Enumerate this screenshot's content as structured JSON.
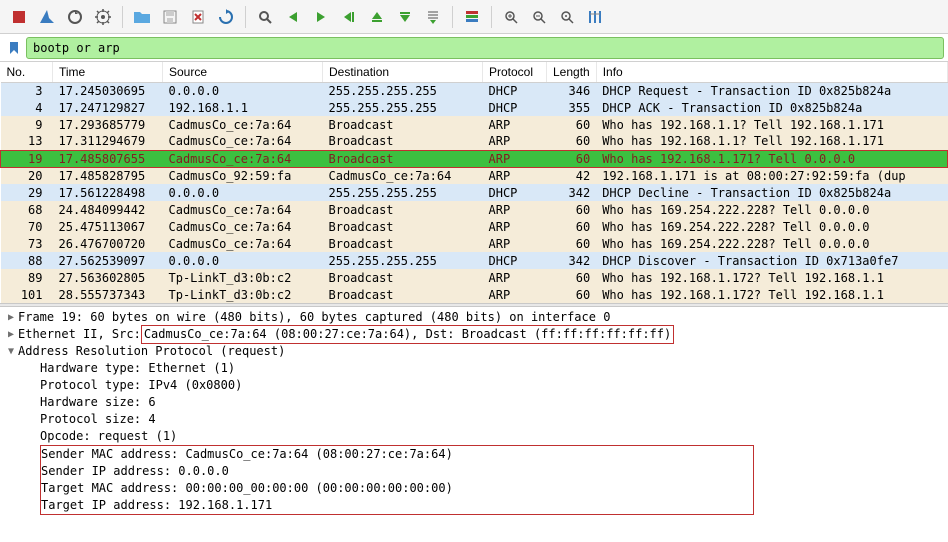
{
  "filter": {
    "value": "bootp or arp"
  },
  "icons": {
    "stop": "stop",
    "fin": "fin",
    "reload": "reload",
    "gear": "gear",
    "folder": "folder",
    "save": "save",
    "close": "close",
    "magnify": "magnify",
    "left": "left",
    "right": "right",
    "jmpl": "jmpl",
    "jmpr": "jmpr",
    "up": "up",
    "down": "down",
    "list": "list",
    "align": "align",
    "zin": "zin",
    "zout": "zout",
    "z100": "z100",
    "cols": "cols"
  },
  "columns": {
    "no": "No.",
    "time": "Time",
    "src": "Source",
    "dst": "Destination",
    "proto": "Protocol",
    "len": "Length",
    "info": "Info"
  },
  "rows": [
    {
      "cls": "row-blue",
      "no": "3",
      "time": "17.245030695",
      "src": "0.0.0.0",
      "dst": "255.255.255.255",
      "proto": "DHCP",
      "len": "346",
      "info": "DHCP Request  - Transaction ID 0x825b824a"
    },
    {
      "cls": "row-blue",
      "no": "4",
      "time": "17.247129827",
      "src": "192.168.1.1",
      "dst": "255.255.255.255",
      "proto": "DHCP",
      "len": "355",
      "info": "DHCP ACK      - Transaction ID 0x825b824a"
    },
    {
      "cls": "row-tan",
      "no": "9",
      "time": "17.293685779",
      "src": "CadmusCo_ce:7a:64",
      "dst": "Broadcast",
      "proto": "ARP",
      "len": "60",
      "info": "Who has 192.168.1.1? Tell 192.168.1.171"
    },
    {
      "cls": "row-tan",
      "no": "13",
      "time": "17.311294679",
      "src": "CadmusCo_ce:7a:64",
      "dst": "Broadcast",
      "proto": "ARP",
      "len": "60",
      "info": "Who has 192.168.1.1? Tell 192.168.1.171"
    },
    {
      "cls": "row-sel",
      "no": "19",
      "time": "17.485807655",
      "src": "CadmusCo_ce:7a:64",
      "dst": "Broadcast",
      "proto": "ARP",
      "len": "60",
      "info": "Who has 192.168.1.171? Tell 0.0.0.0"
    },
    {
      "cls": "row-tan",
      "no": "20",
      "time": "17.485828795",
      "src": "CadmusCo_92:59:fa",
      "dst": "CadmusCo_ce:7a:64",
      "proto": "ARP",
      "len": "42",
      "info": "192.168.1.171 is at 08:00:27:92:59:fa (dup"
    },
    {
      "cls": "row-blue",
      "no": "29",
      "time": "17.561228498",
      "src": "0.0.0.0",
      "dst": "255.255.255.255",
      "proto": "DHCP",
      "len": "342",
      "info": "DHCP Decline  - Transaction ID 0x825b824a"
    },
    {
      "cls": "row-tan",
      "no": "68",
      "time": "24.484099442",
      "src": "CadmusCo_ce:7a:64",
      "dst": "Broadcast",
      "proto": "ARP",
      "len": "60",
      "info": "Who has 169.254.222.228? Tell 0.0.0.0"
    },
    {
      "cls": "row-tan",
      "no": "70",
      "time": "25.475113067",
      "src": "CadmusCo_ce:7a:64",
      "dst": "Broadcast",
      "proto": "ARP",
      "len": "60",
      "info": "Who has 169.254.222.228? Tell 0.0.0.0"
    },
    {
      "cls": "row-tan",
      "no": "73",
      "time": "26.476700720",
      "src": "CadmusCo_ce:7a:64",
      "dst": "Broadcast",
      "proto": "ARP",
      "len": "60",
      "info": "Who has 169.254.222.228? Tell 0.0.0.0"
    },
    {
      "cls": "row-blue",
      "no": "88",
      "time": "27.562539097",
      "src": "0.0.0.0",
      "dst": "255.255.255.255",
      "proto": "DHCP",
      "len": "342",
      "info": "DHCP Discover - Transaction ID 0x713a0fe7"
    },
    {
      "cls": "row-tan",
      "no": "89",
      "time": "27.563602805",
      "src": "Tp-LinkT_d3:0b:c2",
      "dst": "Broadcast",
      "proto": "ARP",
      "len": "60",
      "info": "Who has 192.168.1.172? Tell 192.168.1.1"
    },
    {
      "cls": "row-tan",
      "no": "101",
      "time": "28.555737343",
      "src": "Tp-LinkT_d3:0b:c2",
      "dst": "Broadcast",
      "proto": "ARP",
      "len": "60",
      "info": "Who has 192.168.1.172? Tell 192.168.1.1"
    }
  ],
  "details": {
    "frame": "Frame 19: 60 bytes on wire (480 bits), 60 bytes captured (480 bits) on interface 0",
    "eth_prefix": "Ethernet II, Src: ",
    "eth_box": "CadmusCo_ce:7a:64 (08:00:27:ce:7a:64), Dst: Broadcast (ff:ff:ff:ff:ff:ff)",
    "arp_head": "Address Resolution Protocol (request)",
    "hwtype": "Hardware type: Ethernet (1)",
    "prototype": "Protocol type: IPv4 (0x0800)",
    "hwsize": "Hardware size: 6",
    "protosize": "Protocol size: 4",
    "opcode": "Opcode: request (1)",
    "sender_mac": "Sender MAC address: CadmusCo_ce:7a:64 (08:00:27:ce:7a:64)",
    "sender_ip": "Sender IP address: 0.0.0.0",
    "target_mac": "Target MAC address: 00:00:00_00:00:00 (00:00:00:00:00:00)",
    "target_ip": "Target IP address: 192.168.1.171"
  }
}
